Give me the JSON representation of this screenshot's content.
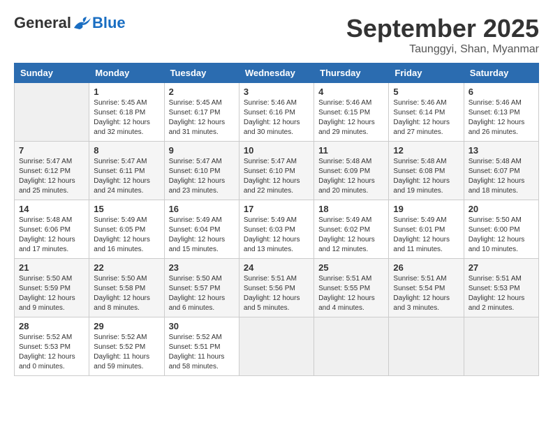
{
  "header": {
    "logo_general": "General",
    "logo_blue": "Blue",
    "month": "September 2025",
    "location": "Taunggyi, Shan, Myanmar"
  },
  "days_of_week": [
    "Sunday",
    "Monday",
    "Tuesday",
    "Wednesday",
    "Thursday",
    "Friday",
    "Saturday"
  ],
  "weeks": [
    [
      {
        "day": "",
        "sunrise": "",
        "sunset": "",
        "daylight": ""
      },
      {
        "day": "1",
        "sunrise": "Sunrise: 5:45 AM",
        "sunset": "Sunset: 6:18 PM",
        "daylight": "Daylight: 12 hours and 32 minutes."
      },
      {
        "day": "2",
        "sunrise": "Sunrise: 5:45 AM",
        "sunset": "Sunset: 6:17 PM",
        "daylight": "Daylight: 12 hours and 31 minutes."
      },
      {
        "day": "3",
        "sunrise": "Sunrise: 5:46 AM",
        "sunset": "Sunset: 6:16 PM",
        "daylight": "Daylight: 12 hours and 30 minutes."
      },
      {
        "day": "4",
        "sunrise": "Sunrise: 5:46 AM",
        "sunset": "Sunset: 6:15 PM",
        "daylight": "Daylight: 12 hours and 29 minutes."
      },
      {
        "day": "5",
        "sunrise": "Sunrise: 5:46 AM",
        "sunset": "Sunset: 6:14 PM",
        "daylight": "Daylight: 12 hours and 27 minutes."
      },
      {
        "day": "6",
        "sunrise": "Sunrise: 5:46 AM",
        "sunset": "Sunset: 6:13 PM",
        "daylight": "Daylight: 12 hours and 26 minutes."
      }
    ],
    [
      {
        "day": "7",
        "sunrise": "Sunrise: 5:47 AM",
        "sunset": "Sunset: 6:12 PM",
        "daylight": "Daylight: 12 hours and 25 minutes."
      },
      {
        "day": "8",
        "sunrise": "Sunrise: 5:47 AM",
        "sunset": "Sunset: 6:11 PM",
        "daylight": "Daylight: 12 hours and 24 minutes."
      },
      {
        "day": "9",
        "sunrise": "Sunrise: 5:47 AM",
        "sunset": "Sunset: 6:10 PM",
        "daylight": "Daylight: 12 hours and 23 minutes."
      },
      {
        "day": "10",
        "sunrise": "Sunrise: 5:47 AM",
        "sunset": "Sunset: 6:10 PM",
        "daylight": "Daylight: 12 hours and 22 minutes."
      },
      {
        "day": "11",
        "sunrise": "Sunrise: 5:48 AM",
        "sunset": "Sunset: 6:09 PM",
        "daylight": "Daylight: 12 hours and 20 minutes."
      },
      {
        "day": "12",
        "sunrise": "Sunrise: 5:48 AM",
        "sunset": "Sunset: 6:08 PM",
        "daylight": "Daylight: 12 hours and 19 minutes."
      },
      {
        "day": "13",
        "sunrise": "Sunrise: 5:48 AM",
        "sunset": "Sunset: 6:07 PM",
        "daylight": "Daylight: 12 hours and 18 minutes."
      }
    ],
    [
      {
        "day": "14",
        "sunrise": "Sunrise: 5:48 AM",
        "sunset": "Sunset: 6:06 PM",
        "daylight": "Daylight: 12 hours and 17 minutes."
      },
      {
        "day": "15",
        "sunrise": "Sunrise: 5:49 AM",
        "sunset": "Sunset: 6:05 PM",
        "daylight": "Daylight: 12 hours and 16 minutes."
      },
      {
        "day": "16",
        "sunrise": "Sunrise: 5:49 AM",
        "sunset": "Sunset: 6:04 PM",
        "daylight": "Daylight: 12 hours and 15 minutes."
      },
      {
        "day": "17",
        "sunrise": "Sunrise: 5:49 AM",
        "sunset": "Sunset: 6:03 PM",
        "daylight": "Daylight: 12 hours and 13 minutes."
      },
      {
        "day": "18",
        "sunrise": "Sunrise: 5:49 AM",
        "sunset": "Sunset: 6:02 PM",
        "daylight": "Daylight: 12 hours and 12 minutes."
      },
      {
        "day": "19",
        "sunrise": "Sunrise: 5:49 AM",
        "sunset": "Sunset: 6:01 PM",
        "daylight": "Daylight: 12 hours and 11 minutes."
      },
      {
        "day": "20",
        "sunrise": "Sunrise: 5:50 AM",
        "sunset": "Sunset: 6:00 PM",
        "daylight": "Daylight: 12 hours and 10 minutes."
      }
    ],
    [
      {
        "day": "21",
        "sunrise": "Sunrise: 5:50 AM",
        "sunset": "Sunset: 5:59 PM",
        "daylight": "Daylight: 12 hours and 9 minutes."
      },
      {
        "day": "22",
        "sunrise": "Sunrise: 5:50 AM",
        "sunset": "Sunset: 5:58 PM",
        "daylight": "Daylight: 12 hours and 8 minutes."
      },
      {
        "day": "23",
        "sunrise": "Sunrise: 5:50 AM",
        "sunset": "Sunset: 5:57 PM",
        "daylight": "Daylight: 12 hours and 6 minutes."
      },
      {
        "day": "24",
        "sunrise": "Sunrise: 5:51 AM",
        "sunset": "Sunset: 5:56 PM",
        "daylight": "Daylight: 12 hours and 5 minutes."
      },
      {
        "day": "25",
        "sunrise": "Sunrise: 5:51 AM",
        "sunset": "Sunset: 5:55 PM",
        "daylight": "Daylight: 12 hours and 4 minutes."
      },
      {
        "day": "26",
        "sunrise": "Sunrise: 5:51 AM",
        "sunset": "Sunset: 5:54 PM",
        "daylight": "Daylight: 12 hours and 3 minutes."
      },
      {
        "day": "27",
        "sunrise": "Sunrise: 5:51 AM",
        "sunset": "Sunset: 5:53 PM",
        "daylight": "Daylight: 12 hours and 2 minutes."
      }
    ],
    [
      {
        "day": "28",
        "sunrise": "Sunrise: 5:52 AM",
        "sunset": "Sunset: 5:53 PM",
        "daylight": "Daylight: 12 hours and 0 minutes."
      },
      {
        "day": "29",
        "sunrise": "Sunrise: 5:52 AM",
        "sunset": "Sunset: 5:52 PM",
        "daylight": "Daylight: 11 hours and 59 minutes."
      },
      {
        "day": "30",
        "sunrise": "Sunrise: 5:52 AM",
        "sunset": "Sunset: 5:51 PM",
        "daylight": "Daylight: 11 hours and 58 minutes."
      },
      {
        "day": "",
        "sunrise": "",
        "sunset": "",
        "daylight": ""
      },
      {
        "day": "",
        "sunrise": "",
        "sunset": "",
        "daylight": ""
      },
      {
        "day": "",
        "sunrise": "",
        "sunset": "",
        "daylight": ""
      },
      {
        "day": "",
        "sunrise": "",
        "sunset": "",
        "daylight": ""
      }
    ]
  ]
}
